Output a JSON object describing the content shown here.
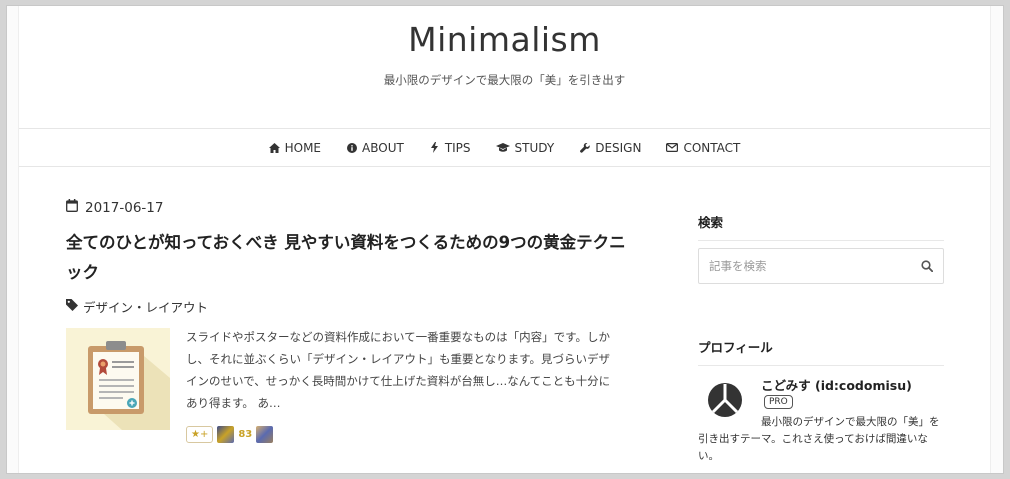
{
  "site": {
    "title": "Minimalism",
    "description": "最小限のデザインで最大限の「美」を引き出す"
  },
  "nav": {
    "items": [
      {
        "label": "HOME",
        "icon": "home-icon"
      },
      {
        "label": "ABOUT",
        "icon": "info-circle-icon"
      },
      {
        "label": "TIPS",
        "icon": "bolt-icon"
      },
      {
        "label": "STUDY",
        "icon": "graduation-cap-icon"
      },
      {
        "label": "DESIGN",
        "icon": "wrench-icon"
      },
      {
        "label": "CONTACT",
        "icon": "envelope-icon"
      }
    ]
  },
  "post": {
    "date": "2017-06-17",
    "title": "全てのひとが知っておくべき 見やすい資料をつくるための9つの黄金テクニック",
    "category": "デザイン・レイアウト",
    "excerpt": "スライドやポスターなどの資料作成において一番重要なものは「内容」です。しかし、それに並ぶくらい「デザイン・レイアウト」も重要となります。見づらいデザインのせいで、せっかく長時間かけて仕上げた資料が台無し…なんてことも十分にあり得ます。 あ…",
    "star_button": "★+",
    "star_count": "83"
  },
  "sidebar": {
    "search_heading": "検索",
    "search_placeholder": "記事を検索",
    "profile_heading": "プロフィール",
    "profile_name": "こどみす (id:codomisu)",
    "profile_badge": "PRO",
    "profile_desc": "最小限のデザインで最大限の「美」を引き出すテーマ。これさえ使っておけば間違いない。"
  },
  "colors": {
    "background": "#ffffff",
    "page_border": "#d4d4d4",
    "text": "#333333",
    "star_gold": "#c9a227",
    "thumb_bg": "#f9f3d6"
  }
}
